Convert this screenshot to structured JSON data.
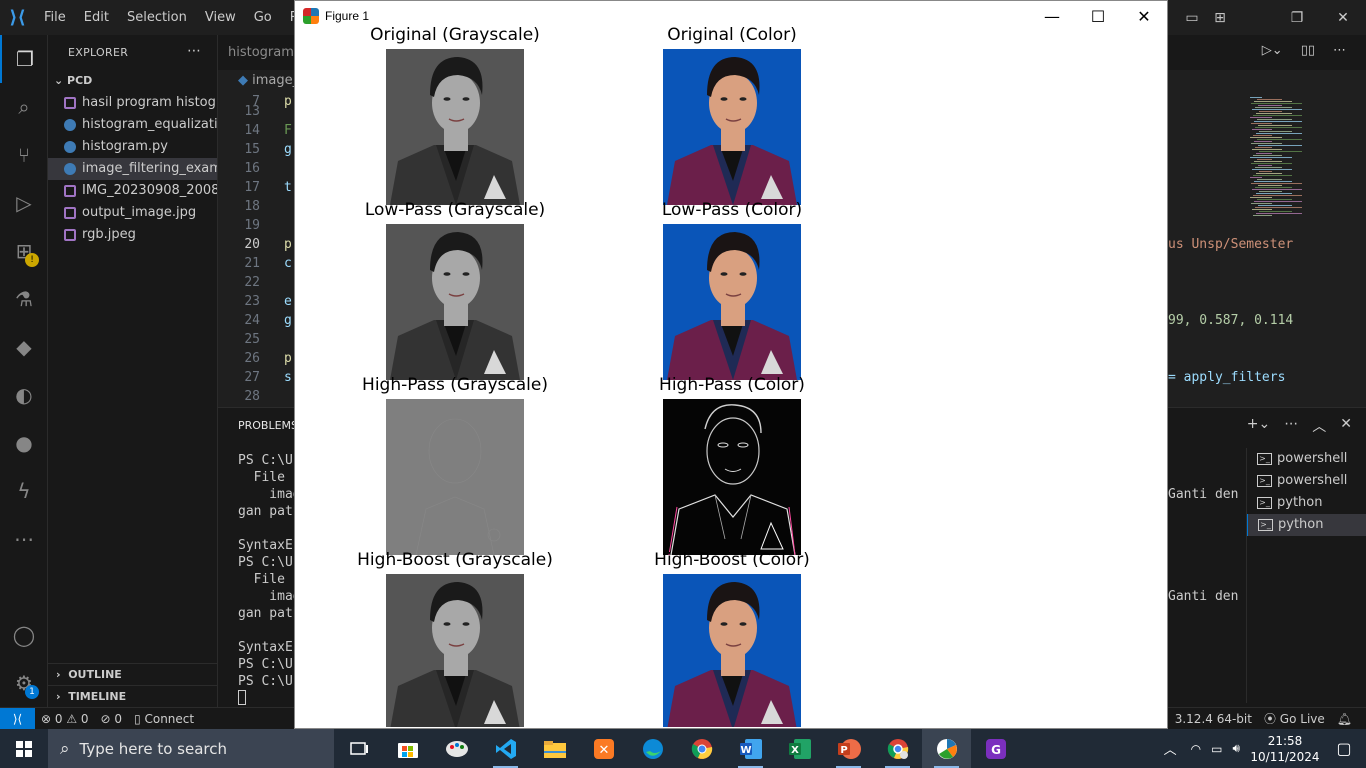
{
  "vscode": {
    "menu": [
      "File",
      "Edit",
      "Selection",
      "View",
      "Go",
      "Run"
    ],
    "explorer_title": "EXPLORER",
    "folder": "PCD",
    "files": [
      {
        "name": "hasil program histogr...",
        "kind": "image"
      },
      {
        "name": "histogram_equalizati...",
        "kind": "python"
      },
      {
        "name": "histogram.py",
        "kind": "python"
      },
      {
        "name": "image_filtering_exam...",
        "kind": "python",
        "active": true
      },
      {
        "name": "IMG_20230908_2008...",
        "kind": "image"
      },
      {
        "name": "output_image.jpg",
        "kind": "image"
      },
      {
        "name": "rgb.jpeg",
        "kind": "image"
      }
    ],
    "outline_label": "OUTLINE",
    "timeline_label": "TIMELINE",
    "tab_label": "histogram.py",
    "breadcrumb": "image_",
    "code_lines": [
      {
        "n": "7",
        "text": "p"
      },
      {
        "n": "13",
        "text": ""
      },
      {
        "n": "14",
        "text": "F"
      },
      {
        "n": "15",
        "text": "g"
      },
      {
        "n": "16",
        "text": ""
      },
      {
        "n": "17",
        "text": "t"
      },
      {
        "n": "18",
        "text": ""
      },
      {
        "n": "19",
        "text": ""
      },
      {
        "n": "20",
        "text": "p"
      },
      {
        "n": "21",
        "text": "c"
      },
      {
        "n": "22",
        "text": ""
      },
      {
        "n": "23",
        "text": "e"
      },
      {
        "n": "24",
        "text": "g"
      },
      {
        "n": "25",
        "text": ""
      },
      {
        "n": "26",
        "text": "p"
      },
      {
        "n": "27",
        "text": "s"
      },
      {
        "n": "28",
        "text": ""
      }
    ],
    "right_code": {
      "line20": "us Unsp/Semester",
      "line24": "99, 0.587, 0.114",
      "line27": "= apply_filters"
    },
    "panel_tab": "PROBLEMS",
    "terminal_lines": [
      "PS C:\\Us",
      "  File \"",
      "    imag",
      "gan path",
      "",
      "SyntaxEr",
      "PS C:\\Us",
      "  File \"",
      "    imag",
      "gan path",
      "",
      "SyntaxEr",
      "PS C:\\Us",
      "PS C:\\Us"
    ],
    "terminal_right": [
      "Ganti den",
      "Ganti den"
    ],
    "terminals": [
      "powershell",
      "powershell",
      "python",
      "python"
    ],
    "status": {
      "errors": "0",
      "warnings": "0",
      "ports": "0",
      "connect": "Connect",
      "python_version": "3.12.4 64-bit",
      "go_live": "Go Live"
    },
    "accounts_badge": "1"
  },
  "figure": {
    "window_title": "Figure 1",
    "panels": [
      {
        "title": "Original (Grayscale)",
        "style": "gray"
      },
      {
        "title": "Original (Color)",
        "style": "color"
      },
      {
        "title": "Low-Pass (Grayscale)",
        "style": "gray"
      },
      {
        "title": "Low-Pass (Color)",
        "style": "color"
      },
      {
        "title": "High-Pass (Grayscale)",
        "style": "hp-gray"
      },
      {
        "title": "High-Pass (Color)",
        "style": "hp-color"
      },
      {
        "title": "High-Boost (Grayscale)",
        "style": "gray"
      },
      {
        "title": "High-Boost (Color)",
        "style": "color"
      }
    ]
  },
  "taskbar": {
    "search_placeholder": "Type here to search",
    "time": "21:58",
    "date": "10/11/2024"
  },
  "colors": {
    "accent": "#0078d4",
    "photo_bg_blue": "#0a55b8",
    "jacket": "#6b1f4a"
  }
}
